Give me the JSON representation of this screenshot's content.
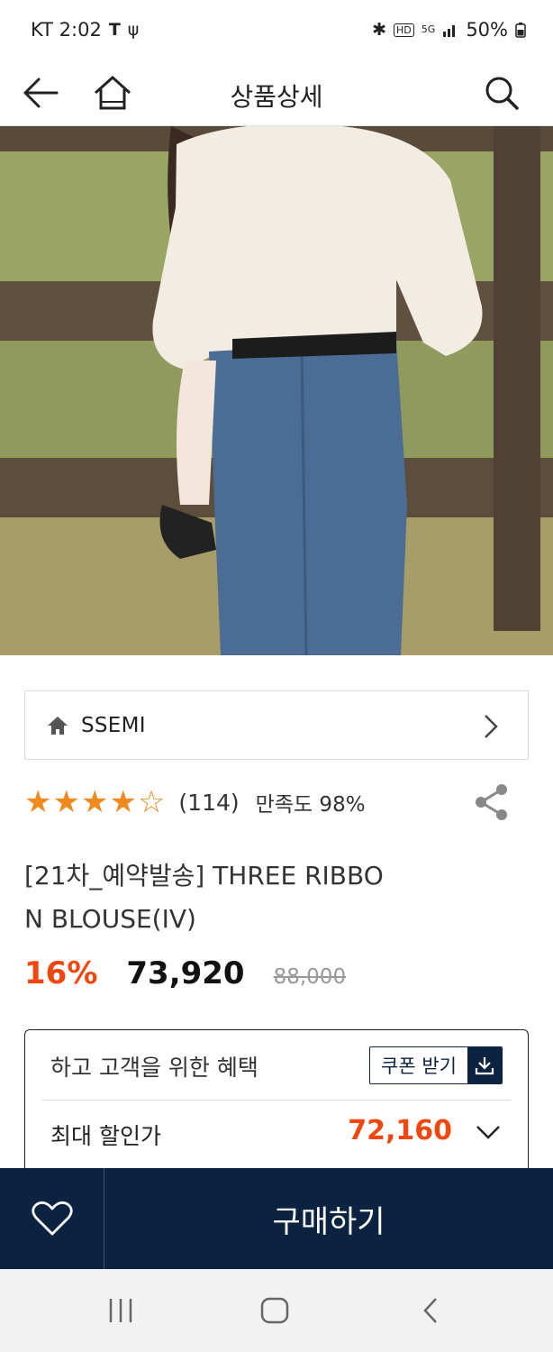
{
  "status_bar": {
    "carrier_time": "KT 2:02",
    "battery": "50%",
    "icons": [
      "t-logo-icon",
      "usb-icon",
      "bluetooth-icon",
      "hd-icon",
      "5g-icon",
      "signal-icon",
      "battery-icon"
    ]
  },
  "header": {
    "title": "상품상세",
    "icons": [
      "back-arrow-icon",
      "home-icon",
      "search-icon"
    ]
  },
  "product": {
    "image_alt": "product-photo",
    "store_name": "SSEMI",
    "rating": {
      "stars_display": "★★★★☆",
      "review_count": "(114)",
      "satisfaction": "만족도 98%"
    },
    "name_line1": "[21차_예약발송] THREE RIBBO",
    "name_line2": "N BLOUSE(IV)",
    "discount": "16%",
    "sale_price": "73,920",
    "original_price": "88,000"
  },
  "benefit": {
    "title": "하고 고객을 위한 혜택",
    "coupon_label": "쿠폰 받기",
    "max_label": "최대 할인가",
    "max_price": "72,160"
  },
  "buy_bar": {
    "buy_label": "구매하기"
  },
  "colors": {
    "accent_orange": "#f0470f",
    "star_orange": "#f08a1e",
    "navy": "#0b2340"
  }
}
